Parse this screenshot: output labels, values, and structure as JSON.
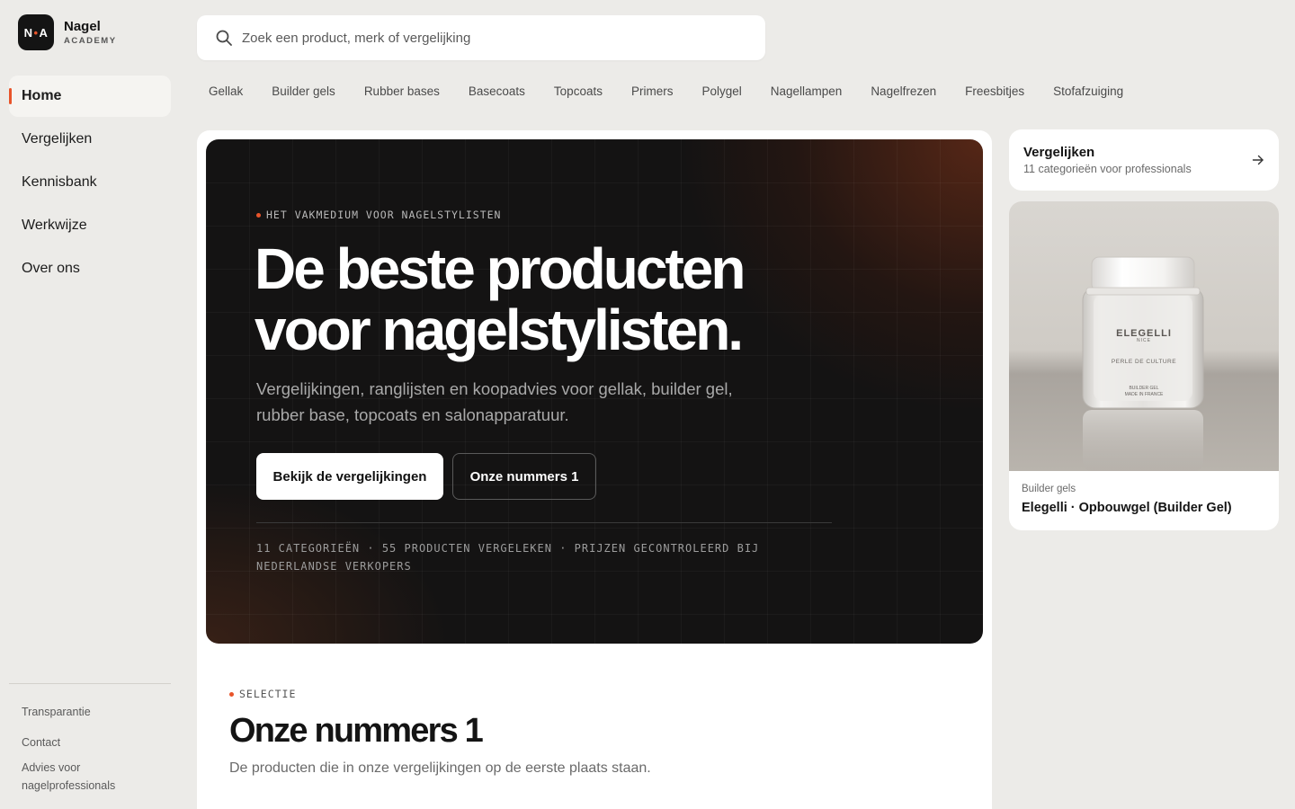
{
  "brand": {
    "logo_mark_left": "N",
    "logo_mark_dot": "•",
    "logo_mark_right": "A",
    "name": "Nagel",
    "sub": "ACADEMY"
  },
  "nav": {
    "items": [
      {
        "label": "Home",
        "active": true
      },
      {
        "label": "Vergelijken"
      },
      {
        "label": "Kennisbank"
      },
      {
        "label": "Werkwijze"
      },
      {
        "label": "Over ons"
      }
    ]
  },
  "footer_links": [
    "Transparantie",
    "Contact",
    "Advies voor nagelprofessionals"
  ],
  "search": {
    "placeholder": "Zoek een product, merk of vergelijking",
    "value": ""
  },
  "categories": [
    "Gellak",
    "Builder gels",
    "Rubber bases",
    "Basecoats",
    "Topcoats",
    "Primers",
    "Polygel",
    "Nagellampen",
    "Nagelfrezen",
    "Freesbitjes",
    "Stofafzuiging"
  ],
  "hero": {
    "eyebrow": "HET VAKMEDIUM VOOR NAGELSTYLISTEN",
    "title_line1": "De beste producten",
    "title_line2": "voor nagelstylisten.",
    "subtitle": "Vergelijkingen, ranglijsten en koopadvies voor gellak, builder gel, rubber base, topcoats en salonapparatuur.",
    "primary_button": "Bekijk de vergelijkingen",
    "secondary_button": "Onze nummers 1",
    "stats": "11 CATEGORIEËN · 55 PRODUCTEN VERGELEKEN · PRIJZEN GECONTROLEERD BIJ NEDERLANDSE VERKOPERS"
  },
  "selection": {
    "eyebrow": "SELECTIE",
    "title": "Onze nummers 1",
    "subtitle": "De producten die in onze vergelijkingen op de eerste plaats staan."
  },
  "compare_card": {
    "title": "Vergelijken",
    "subtitle": "11 categorieën voor professionals"
  },
  "product_card": {
    "category": "Builder gels",
    "name": "Elegelli · Opbouwgel (Builder Gel)",
    "jar_brand": "ELEGELLI",
    "jar_city": "NICE",
    "jar_line": "PERLE DE CULTURE",
    "jar_type": "BUILDER GEL",
    "jar_origin": "MADE IN FRANCE"
  },
  "colors": {
    "accent": "#e8542a",
    "hero_bg": "#141313",
    "page_bg": "#ecebe8"
  }
}
